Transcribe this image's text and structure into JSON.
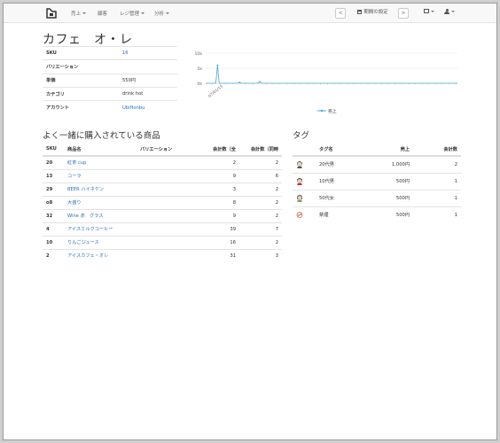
{
  "navbar": {
    "menu": [
      {
        "label": "売上",
        "dropdown": true
      },
      {
        "label": "顧客",
        "dropdown": false
      },
      {
        "label": "レジ管理",
        "dropdown": true
      },
      {
        "label": "分析",
        "dropdown": true
      }
    ],
    "prev_label": "<",
    "period_label": "期間の設定",
    "next_label": ">"
  },
  "page": {
    "title": "カフェ　オ・レ"
  },
  "info": [
    {
      "key": "SKU",
      "value": "16",
      "link": true
    },
    {
      "key": "バリエーション",
      "value": "",
      "link": false
    },
    {
      "key": "単価",
      "value": "550円",
      "link": false
    },
    {
      "key": "カテゴリ",
      "value": "drink hot",
      "link": false
    },
    {
      "key": "アカウント",
      "value": "UbiHonbu",
      "link": true
    }
  ],
  "chart_data": {
    "type": "line",
    "y_ticks": [
      "10k",
      "5k",
      "0k"
    ],
    "ylim": [
      0,
      10000
    ],
    "x_tick_label": "07/01/15",
    "legend": "売上",
    "color": "#4aa3d8",
    "values": [
      0,
      0,
      0,
      0,
      0,
      0,
      0,
      6000,
      0,
      0,
      0,
      0,
      0,
      0,
      0,
      0,
      0,
      0,
      0,
      0,
      300,
      0,
      0,
      0,
      0,
      0,
      0,
      0,
      0,
      0,
      0,
      0,
      500,
      0,
      0,
      0,
      0,
      0,
      0,
      0,
      0,
      0,
      0,
      0,
      0,
      0,
      0,
      0,
      0,
      0,
      0,
      0,
      0,
      0,
      0,
      0,
      0,
      0,
      0,
      0,
      0,
      0,
      0,
      0,
      0,
      0,
      0,
      0,
      0,
      0,
      0,
      0,
      0,
      0,
      0,
      0,
      0,
      0,
      0,
      0,
      0,
      0,
      0,
      0,
      0,
      0,
      0,
      0,
      0,
      0,
      0,
      0,
      0,
      0,
      0,
      0,
      0,
      0,
      0,
      0,
      0,
      0,
      0,
      0,
      0,
      0,
      0,
      0,
      0,
      0,
      0,
      0,
      0,
      0,
      0,
      0,
      0,
      0,
      0,
      0,
      0,
      0,
      0,
      0,
      0,
      0,
      0,
      0,
      0,
      0,
      0,
      0,
      0,
      0,
      0,
      0,
      0,
      0,
      0,
      0,
      0,
      0,
      0,
      0,
      0,
      0,
      0,
      0,
      0,
      0
    ]
  },
  "products": {
    "heading": "よく一緒に購入されている商品",
    "columns": [
      "SKU",
      "商品名",
      "バリエーション",
      "会計数（全",
      "会計数（同時"
    ],
    "rows": [
      {
        "sku": "20",
        "name": "紅茶 cup",
        "variation": "",
        "total": "2",
        "together": "2"
      },
      {
        "sku": "13",
        "name": "コーラ",
        "variation": "",
        "total": "9",
        "together": "6"
      },
      {
        "sku": "29",
        "name": "BEER ハイネケン",
        "variation": "",
        "total": "3",
        "together": "2"
      },
      {
        "sku": "o8",
        "name": "大盛り",
        "variation": "",
        "total": "8",
        "together": "2"
      },
      {
        "sku": "32",
        "name": "Wine 赤　グラス",
        "variation": "",
        "total": "9",
        "together": "2"
      },
      {
        "sku": "4",
        "name": "アイスミルクコーヒー",
        "variation": "",
        "total": "39",
        "together": "7"
      },
      {
        "sku": "10",
        "name": "りんごジュース",
        "variation": "",
        "total": "16",
        "together": "2"
      },
      {
        "sku": "2",
        "name": "アイスカフェ・オレ",
        "variation": "",
        "total": "31",
        "together": "3"
      }
    ]
  },
  "tags": {
    "heading": "タグ",
    "columns": [
      "",
      "タグ名",
      "売上",
      "会計数"
    ],
    "rows": [
      {
        "icon": "man-20s-icon",
        "name": "20代男",
        "sales": "1,000円",
        "count": "2"
      },
      {
        "icon": "man-10s-icon",
        "name": "10代男",
        "sales": "500円",
        "count": "1"
      },
      {
        "icon": "woman-50s-icon",
        "name": "50代女",
        "sales": "500円",
        "count": "1"
      },
      {
        "icon": "no-smoking-icon",
        "name": "禁煙",
        "sales": "500円",
        "count": "1"
      }
    ]
  }
}
